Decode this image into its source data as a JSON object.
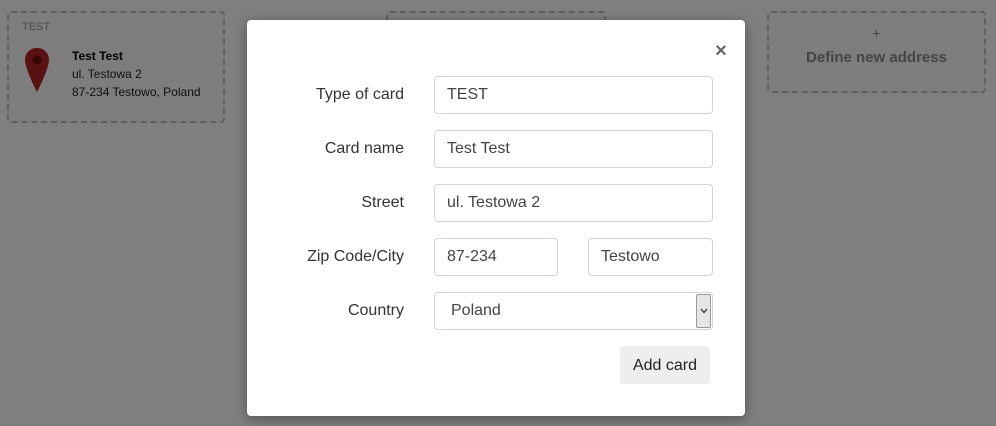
{
  "background": {
    "address_card": {
      "tag": "TEST",
      "name": "Test Test",
      "street": "ul. Testowa 2",
      "city_line": "87-234 Testowo, Poland",
      "pin_color": "#b22222"
    },
    "new_address": {
      "plus": "+",
      "label": "Define new address"
    }
  },
  "modal": {
    "close_glyph": "×",
    "fields": {
      "type_of_card": {
        "label": "Type of card",
        "value": "TEST"
      },
      "card_name": {
        "label": "Card name",
        "value": "Test Test"
      },
      "street": {
        "label": "Street",
        "value": "ul. Testowa 2"
      },
      "zip_city": {
        "label": "Zip Code/City",
        "zip": "87-234",
        "city": "Testowo"
      },
      "country": {
        "label": "Country",
        "selected": "Poland"
      }
    },
    "submit_label": "Add card"
  }
}
